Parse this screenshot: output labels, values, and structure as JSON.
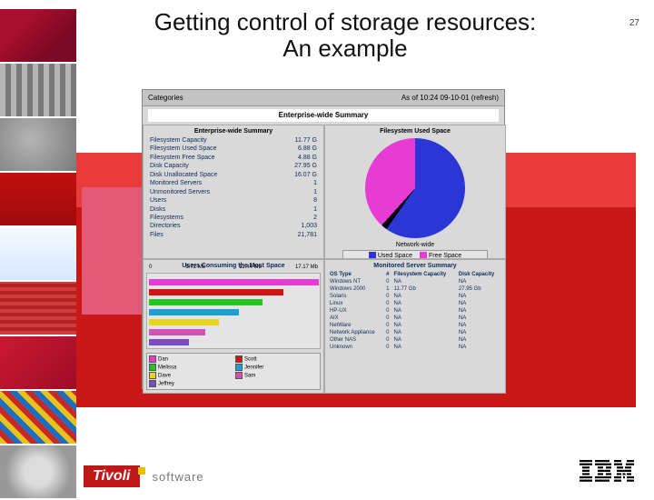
{
  "page_number": "27",
  "title_line1": "Getting control of storage resources:",
  "title_line2": "An example",
  "footer": {
    "tivoli": "Tivoli",
    "software": "software",
    "ibm": "IBM"
  },
  "screenshot": {
    "left_label": "Categories",
    "timestamp": "As of 10:24 09-10-01 (refresh)",
    "panel_title": "Enterprise-wide Summary",
    "summary": {
      "heading": "Enterprise-wide Summary",
      "rows": [
        {
          "k": "Filesystem Capacity",
          "v": "11.77 G"
        },
        {
          "k": "Filesystem Used Space",
          "v": "6.88 G"
        },
        {
          "k": "Filesystem Free Space",
          "v": "4.88 G"
        },
        {
          "k": "Disk Capacity",
          "v": "27.95 G"
        },
        {
          "k": "Disk Unallocated Space",
          "v": "16.07 G"
        },
        {
          "k": "Monitored Servers",
          "v": "1"
        },
        {
          "k": "Unmonitored Servers",
          "v": "1"
        },
        {
          "k": "Users",
          "v": "8"
        },
        {
          "k": "Disks",
          "v": "1"
        },
        {
          "k": "Filesystems",
          "v": "2"
        },
        {
          "k": "Directories",
          "v": "1,003"
        },
        {
          "k": "Files",
          "v": "21,781"
        }
      ]
    },
    "pie": {
      "heading": "Filesystem Used Space",
      "center_label": "Network-wide",
      "legend": [
        {
          "label": "Used Space",
          "color": "#2a36d6"
        },
        {
          "label": "Free Space",
          "color": "#e63bd4"
        }
      ]
    },
    "bars": {
      "heading": "Users Consuming the Most Space",
      "axis": [
        "0",
        "5.72 Mb",
        "11.44 Mb",
        "17.17 Mb"
      ],
      "legend": [
        {
          "label": "Dan",
          "color": "#e63bd4"
        },
        {
          "label": "Scott",
          "color": "#d11313"
        },
        {
          "label": "Melissa",
          "color": "#25c425"
        },
        {
          "label": "Jennifer",
          "color": "#1da0d1"
        },
        {
          "label": "Dave",
          "color": "#e6d21f"
        },
        {
          "label": "Sam",
          "color": "#cf52b5"
        },
        {
          "label": "Jeffrey",
          "color": "#7a4ec2"
        }
      ]
    },
    "os_table": {
      "heading": "Monitored Server Summary",
      "cols": [
        "OS Type",
        "#",
        "Filesystem Capacity",
        "Disk Capacity"
      ],
      "rows": [
        [
          "Windows NT",
          "0",
          "NA",
          "NA"
        ],
        [
          "Windows 2000",
          "1",
          "11.77 Gb",
          "27.95 Gb"
        ],
        [
          "Solaris",
          "0",
          "NA",
          "NA"
        ],
        [
          "Linux",
          "0",
          "NA",
          "NA"
        ],
        [
          "HP-UX",
          "0",
          "NA",
          "NA"
        ],
        [
          "AIX",
          "0",
          "NA",
          "NA"
        ],
        [
          "NetWare",
          "0",
          "NA",
          "NA"
        ],
        [
          "Network Appliance",
          "0",
          "NA",
          "NA"
        ],
        [
          "Other NAS",
          "0",
          "NA",
          "NA"
        ],
        [
          "Unknown",
          "0",
          "NA",
          "NA"
        ]
      ]
    }
  },
  "chart_data": [
    {
      "type": "pie",
      "title": "Filesystem Used Space",
      "series": [
        {
          "name": "Used Space",
          "value": 6.88
        },
        {
          "name": "Free Space",
          "value": 4.88
        }
      ],
      "unit": "Gb"
    },
    {
      "type": "bar",
      "orientation": "horizontal",
      "title": "Users Consuming the Most Space",
      "xlabel": "Mb",
      "xlim": [
        0,
        17.17
      ],
      "categories": [
        "Dan",
        "Scott",
        "Melissa",
        "Jennifer",
        "Dave",
        "Sam",
        "Jeffrey"
      ],
      "values": [
        17.1,
        13.5,
        11.4,
        9.0,
        7.0,
        5.7,
        4.0
      ]
    },
    {
      "type": "table",
      "title": "Monitored Server Summary",
      "columns": [
        "OS Type",
        "#",
        "Filesystem Capacity",
        "Disk Capacity"
      ],
      "rows": [
        [
          "Windows NT",
          0,
          "NA",
          "NA"
        ],
        [
          "Windows 2000",
          1,
          "11.77 Gb",
          "27.95 Gb"
        ],
        [
          "Solaris",
          0,
          "NA",
          "NA"
        ],
        [
          "Linux",
          0,
          "NA",
          "NA"
        ],
        [
          "HP-UX",
          0,
          "NA",
          "NA"
        ],
        [
          "AIX",
          0,
          "NA",
          "NA"
        ],
        [
          "NetWare",
          0,
          "NA",
          "NA"
        ],
        [
          "Network Appliance",
          0,
          "NA",
          "NA"
        ],
        [
          "Other NAS",
          0,
          "NA",
          "NA"
        ],
        [
          "Unknown",
          0,
          "NA",
          "NA"
        ]
      ]
    }
  ]
}
